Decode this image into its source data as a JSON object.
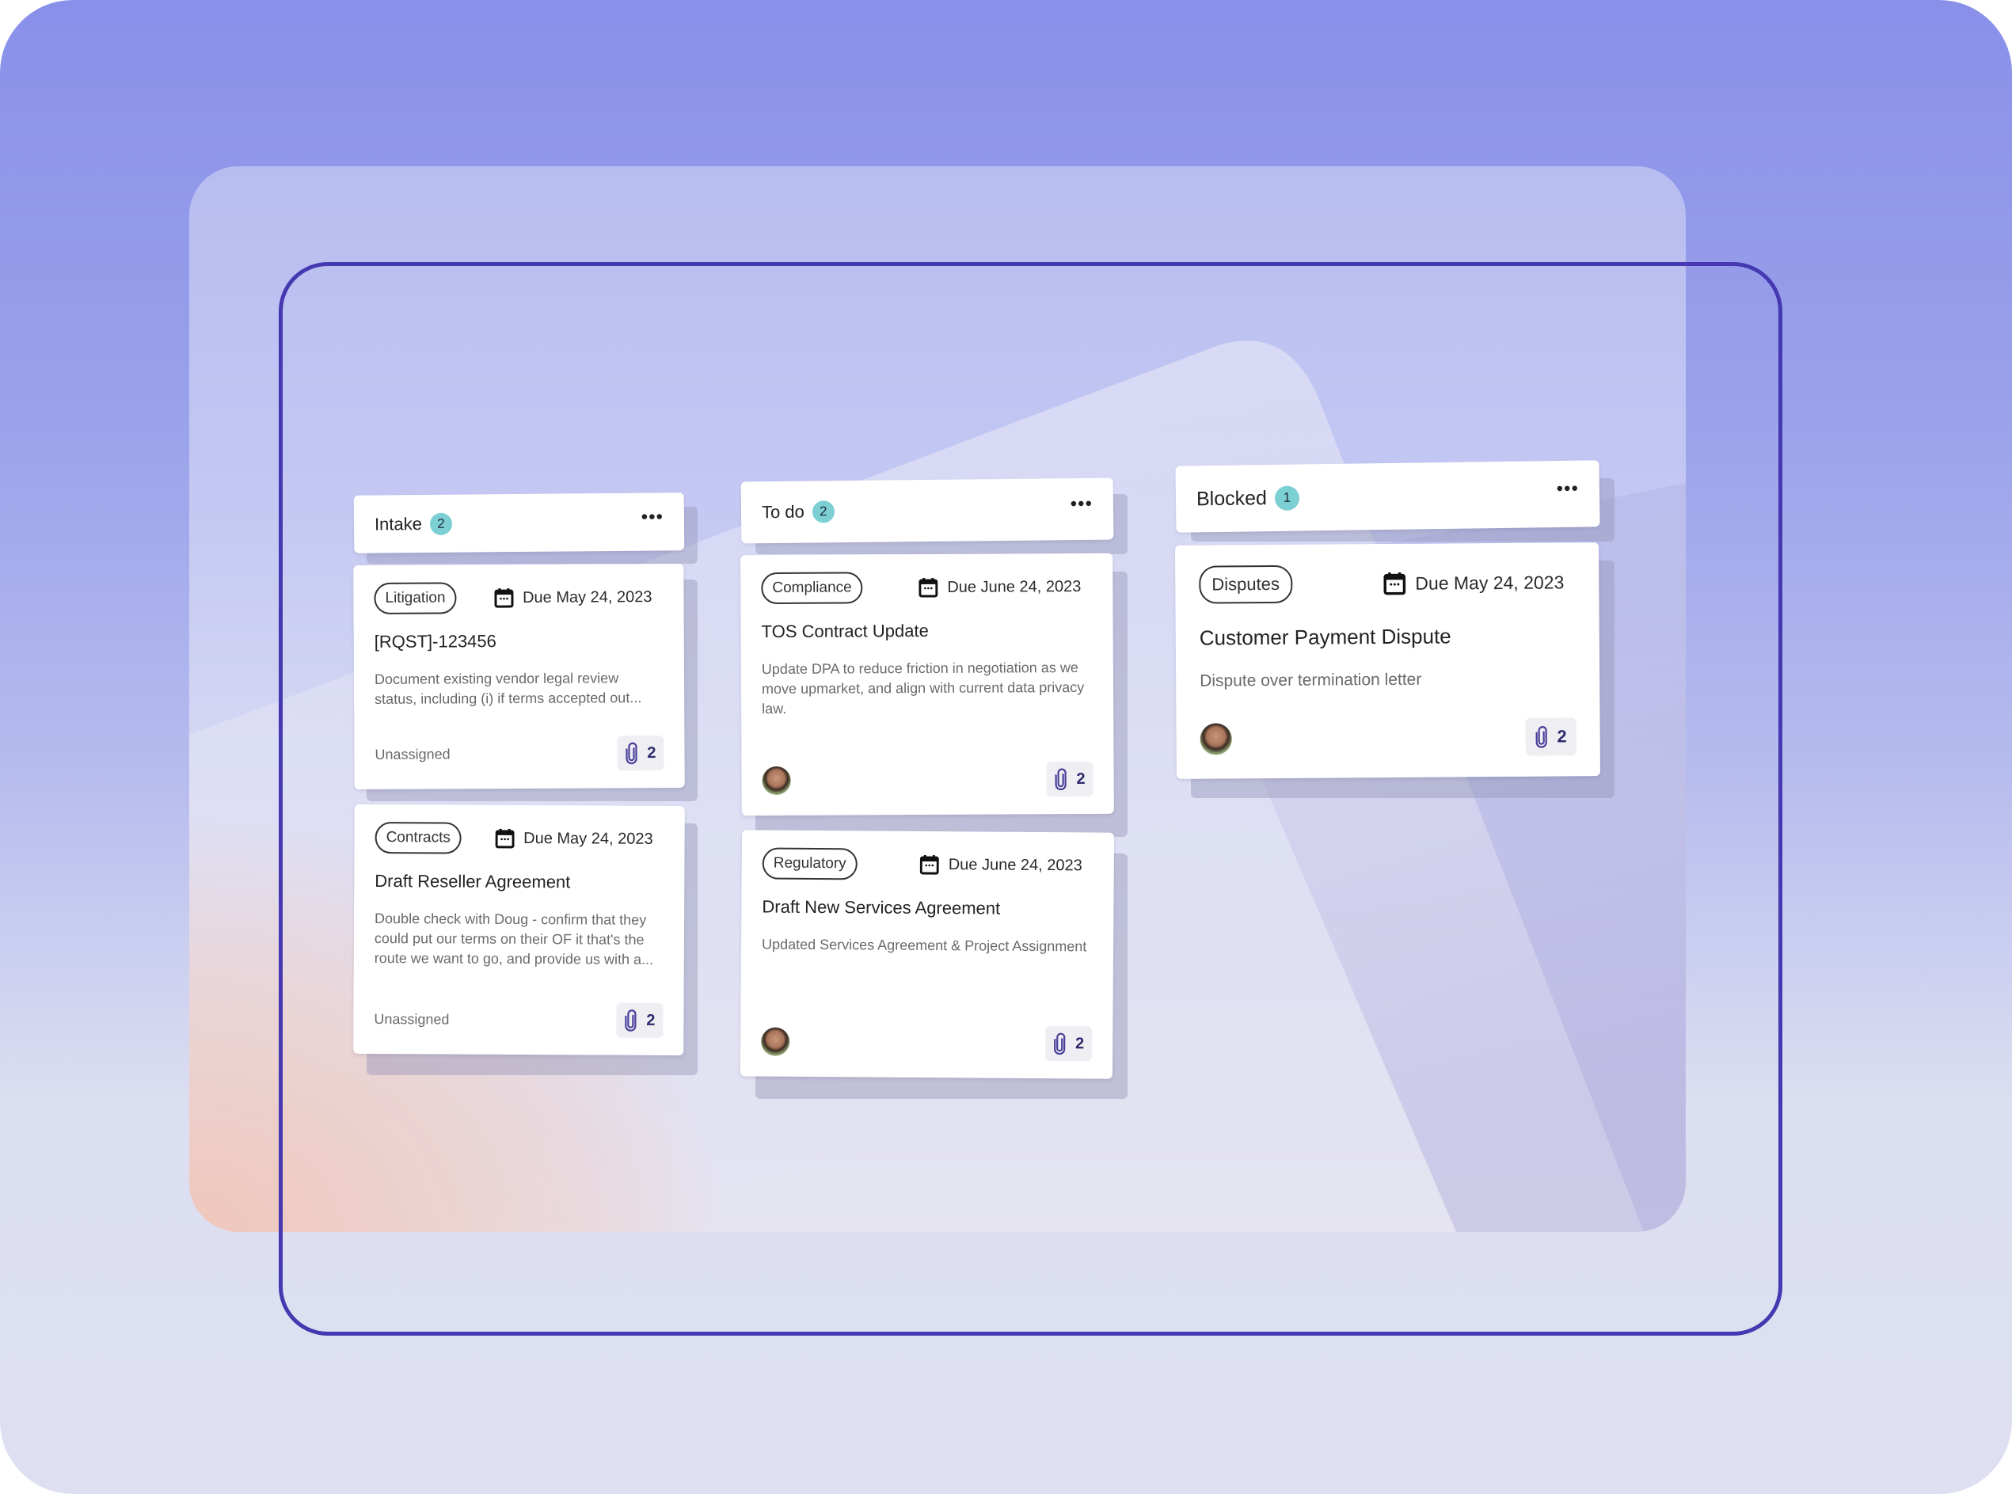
{
  "colors": {
    "frame_outline": "#4538b0",
    "count_badge": "#7ccfd3",
    "attachment_icon": "#4a3f9a",
    "attachment_count": "#2e2a6e"
  },
  "board": {
    "columns": [
      {
        "title": "Intake",
        "count": "2",
        "more_icon": "ellipsis-horizontal-icon",
        "cards": [
          {
            "tag": "Litigation",
            "due": "Due May 24, 2023",
            "title": "[RQST]-123456",
            "description": "Document existing vendor legal review status, including (i) if terms accepted out...",
            "assignee": "Unassigned",
            "attachments": "2"
          },
          {
            "tag": "Contracts",
            "due": "Due May 24, 2023",
            "title": "Draft Reseller Agreement",
            "description": "Double check with Doug - confirm that they could put our terms on their OF it that's the route we want to go, and provide us with a...",
            "assignee": "Unassigned",
            "attachments": "2"
          }
        ]
      },
      {
        "title": "To do",
        "count": "2",
        "more_icon": "ellipsis-horizontal-icon",
        "cards": [
          {
            "tag": "Compliance",
            "due": "Due June 24, 2023",
            "title": "TOS Contract Update",
            "description": "Update DPA to reduce friction in negotiation as we move upmarket, and align with current data privacy law.",
            "assignee_avatar": "user-avatar",
            "attachments": "2"
          },
          {
            "tag": "Regulatory",
            "due": "Due June 24, 2023",
            "title": "Draft New Services Agreement",
            "description": "Updated Services Agreement & Project Assignment",
            "assignee_avatar": "user-avatar",
            "attachments": "2"
          }
        ]
      },
      {
        "title": "Blocked",
        "count": "1",
        "more_icon": "ellipsis-horizontal-icon",
        "cards": [
          {
            "tag": "Disputes",
            "due": "Due May 24, 2023",
            "title": "Customer Payment Dispute",
            "description": "Dispute over termination letter",
            "assignee_avatar": "user-avatar",
            "attachments": "2"
          }
        ]
      }
    ]
  }
}
